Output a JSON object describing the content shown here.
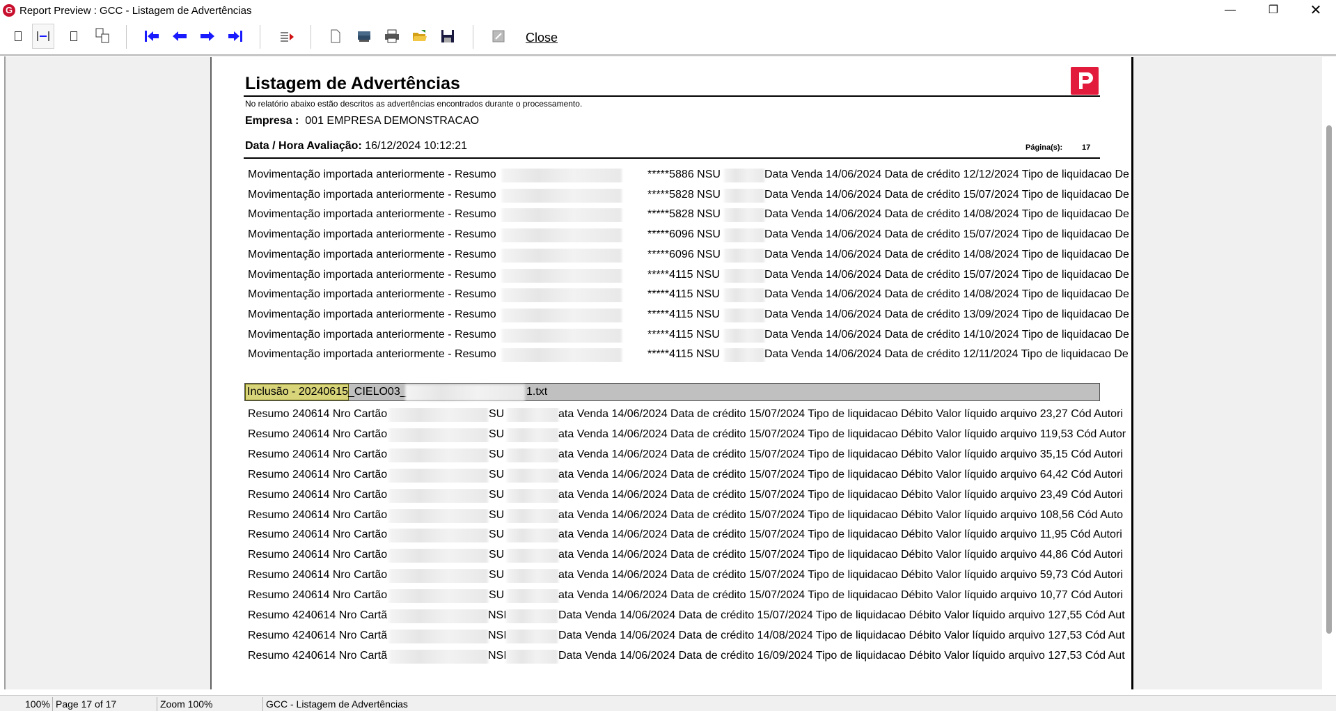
{
  "window": {
    "title": "Report Preview : GCC - Listagem de Advertências",
    "logo_letter": "G"
  },
  "toolbar": {
    "close_label": "Close",
    "buttons": [
      "single-page",
      "page-width",
      "full-page",
      "multi-page",
      "first-page",
      "previous-page",
      "next-page",
      "last-page",
      "go-to-page",
      "new-document",
      "export",
      "print",
      "open",
      "save",
      "edit"
    ]
  },
  "report": {
    "title": "Listagem de Advertências",
    "description": "No relatório abaixo estão descritos as advertências encontrados durante o processamento.",
    "empresa_label": "Empresa :",
    "empresa_value": "001 EMPRESA DEMONSTRACAO",
    "datahora_label": "Data / Hora Avaliação:",
    "datahora_value": "16/12/2024 10:12:21",
    "pagina_label": "Página(s):",
    "pagina_value": "17",
    "brand_color": "#e21b3c",
    "section1_rows": [
      {
        "prefix": "Movimentação importada anteriormente - Resumo",
        "card": "*****5886 NSU",
        "rest": "Data Venda 14/06/2024 Data de crédito 12/12/2024 Tipo de liquidacao De"
      },
      {
        "prefix": "Movimentação importada anteriormente - Resumo",
        "card": "*****5828 NSU",
        "rest": "Data Venda 14/06/2024 Data de crédito 15/07/2024 Tipo de liquidacao De"
      },
      {
        "prefix": "Movimentação importada anteriormente - Resumo",
        "card": "*****5828 NSU",
        "rest": "Data Venda 14/06/2024 Data de crédito 14/08/2024 Tipo de liquidacao De"
      },
      {
        "prefix": "Movimentação importada anteriormente - Resumo",
        "card": "*****6096 NSU",
        "rest": "Data Venda 14/06/2024 Data de crédito 15/07/2024 Tipo de liquidacao De"
      },
      {
        "prefix": "Movimentação importada anteriormente - Resumo",
        "card": "*****6096 NSU",
        "rest": "Data Venda 14/06/2024 Data de crédito 14/08/2024 Tipo de liquidacao De"
      },
      {
        "prefix": "Movimentação importada anteriormente - Resumo",
        "card": "*****4115 NSU",
        "rest": "Data Venda 14/06/2024 Data de crédito 15/07/2024 Tipo de liquidacao De"
      },
      {
        "prefix": "Movimentação importada anteriormente - Resumo",
        "card": "*****4115 NSU",
        "rest": "Data Venda 14/06/2024 Data de crédito 14/08/2024 Tipo de liquidacao De"
      },
      {
        "prefix": "Movimentação importada anteriormente - Resumo",
        "card": "*****4115 NSU",
        "rest": "Data Venda 14/06/2024 Data de crédito 13/09/2024 Tipo de liquidacao De"
      },
      {
        "prefix": "Movimentação importada anteriormente - Resumo",
        "card": "*****4115 NSU",
        "rest": "Data Venda 14/06/2024 Data de crédito 14/10/2024 Tipo de liquidacao De"
      },
      {
        "prefix": "Movimentação importada anteriormente - Resumo",
        "card": "*****4115 NSU",
        "rest": "Data Venda 14/06/2024 Data de crédito 12/11/2024 Tipo de liquidacao De"
      }
    ],
    "inclusion_label": "Inclusão - 20240615",
    "inclusion_mid": "_CIELO03_",
    "inclusion_suffix": "1.txt",
    "section2_rows": [
      {
        "prefix": "Resumo 240614 Nro Cartão",
        "nsu": "SU",
        "rest": "ata Venda 14/06/2024 Data de crédito 15/07/2024 Tipo de liquidacao Débito Valor líquido arquivo 23,27 Cód Autori"
      },
      {
        "prefix": "Resumo 240614 Nro Cartão",
        "nsu": "SU",
        "rest": "ata Venda 14/06/2024 Data de crédito 15/07/2024 Tipo de liquidacao Débito Valor líquido arquivo 119,53 Cód Autor"
      },
      {
        "prefix": "Resumo 240614 Nro Cartão",
        "nsu": "SU",
        "rest": "ata Venda 14/06/2024 Data de crédito 15/07/2024 Tipo de liquidacao Débito Valor líquido arquivo 35,15 Cód Autori"
      },
      {
        "prefix": "Resumo 240614 Nro Cartão",
        "nsu": "SU",
        "rest": "ata Venda 14/06/2024 Data de crédito 15/07/2024 Tipo de liquidacao Débito Valor líquido arquivo 64,42 Cód Autori"
      },
      {
        "prefix": "Resumo 240614 Nro Cartão",
        "nsu": "SU",
        "rest": "ata Venda 14/06/2024 Data de crédito 15/07/2024 Tipo de liquidacao Débito Valor líquido arquivo 23,49 Cód Autori"
      },
      {
        "prefix": "Resumo 240614 Nro Cartão",
        "nsu": "SU",
        "rest": "ata Venda 14/06/2024 Data de crédito 15/07/2024 Tipo de liquidacao Débito Valor líquido arquivo 108,56 Cód Auto"
      },
      {
        "prefix": "Resumo 240614 Nro Cartão",
        "nsu": "SU",
        "rest": "ata Venda 14/06/2024 Data de crédito 15/07/2024 Tipo de liquidacao Débito Valor líquido arquivo 11,95 Cód Autori"
      },
      {
        "prefix": "Resumo 240614 Nro Cartão",
        "nsu": "SU",
        "rest": "ata Venda 14/06/2024 Data de crédito 15/07/2024 Tipo de liquidacao Débito Valor líquido arquivo 44,86 Cód Autori"
      },
      {
        "prefix": "Resumo 240614 Nro Cartão",
        "nsu": "SU",
        "rest": "ata Venda 14/06/2024 Data de crédito 15/07/2024 Tipo de liquidacao Débito Valor líquido arquivo 59,73 Cód Autori"
      },
      {
        "prefix": "Resumo 240614 Nro Cartão",
        "nsu": "SU",
        "rest": "ata Venda 14/06/2024 Data de crédito 15/07/2024 Tipo de liquidacao Débito Valor líquido arquivo 10,77 Cód Autori"
      },
      {
        "prefix": "Resumo 4240614 Nro Cartã",
        "nsu": "NSI",
        "rest": "Data Venda 14/06/2024 Data de crédito 15/07/2024 Tipo de liquidacao Débito Valor líquido arquivo 127,55 Cód Aut"
      },
      {
        "prefix": "Resumo 4240614 Nro Cartã",
        "nsu": "NSI",
        "rest": "Data Venda 14/06/2024 Data de crédito 14/08/2024 Tipo de liquidacao Débito Valor líquido arquivo 127,53 Cód Aut"
      },
      {
        "prefix": "Resumo 4240614 Nro Cartã",
        "nsu": "NSI",
        "rest": "Data Venda 14/06/2024 Data de crédito 16/09/2024 Tipo de liquidacao Débito Valor líquido arquivo 127,53 Cód Aut"
      }
    ]
  },
  "status": {
    "zoom_percent": "100%",
    "page": "Page 17 of 17",
    "zoom_label": "Zoom 100%",
    "report_name": "GCC - Listagem de Advertências"
  }
}
